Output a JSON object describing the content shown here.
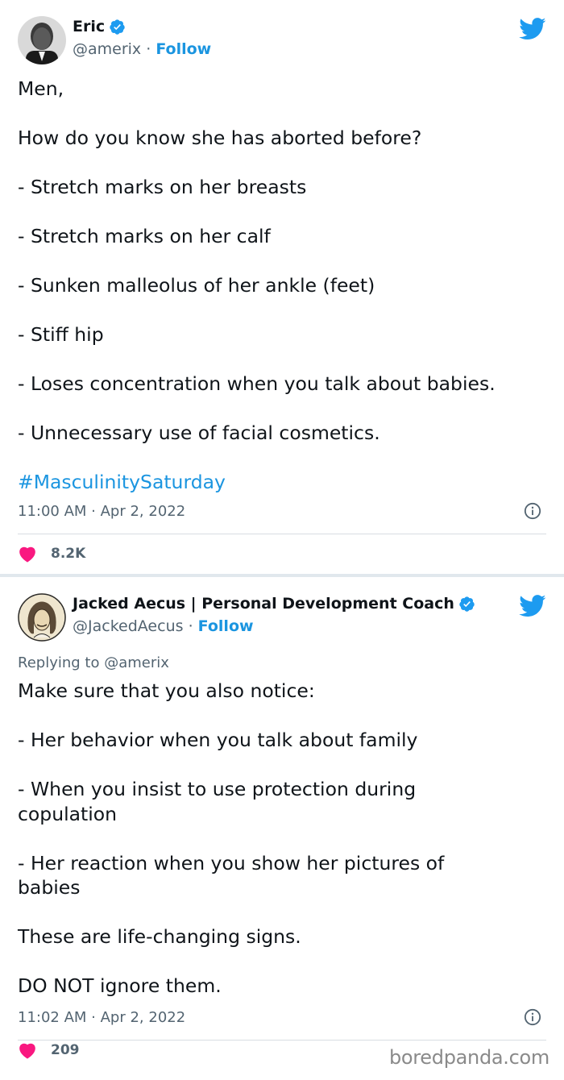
{
  "tweets": [
    {
      "author": {
        "name": "Eric",
        "handle": "@amerix",
        "separator": "·",
        "follow_label": "Follow",
        "verified": true
      },
      "body_paragraphs": [
        "Men,",
        "How do you know she has aborted before?",
        "- Stretch marks on her breasts",
        "- Stretch marks on her calf",
        "- Sunken malleolus of her ankle (feet)",
        "- Stiff hip",
        "- Loses concentration when you talk about babies.",
        "- Unnecessary use of facial cosmetics."
      ],
      "hashtag": "#MasculinitySaturday",
      "timestamp": "11:00 AM · Apr 2, 2022",
      "likes": "8.2K"
    },
    {
      "author": {
        "name": "Jacked Aecus | Personal Development Coach",
        "handle": "@JackedAecus",
        "separator": "·",
        "follow_label": "Follow",
        "verified": true
      },
      "reply_prefix": "Replying to",
      "reply_handle": "@amerix",
      "body_paragraphs": [
        "Make sure that you also notice:",
        "- Her behavior when you talk about family",
        "- When you insist to use protection during copulation",
        "- Her reaction when you show her pictures of babies",
        "These are life-changing signs.",
        "DO NOT ignore them."
      ],
      "timestamp": "11:02 AM · Apr 2, 2022",
      "likes": "209"
    }
  ],
  "watermark": "boredpanda.com",
  "colors": {
    "link_blue": "#1b95e0",
    "verified_blue": "#1d9bf0",
    "heart_pink": "#f91880",
    "muted_gray": "#536471",
    "separator": "#e1e8ed"
  },
  "icons": {
    "brand": "twitter-bird-icon",
    "verified": "verified-badge-icon",
    "like": "heart-icon",
    "info": "info-icon"
  }
}
